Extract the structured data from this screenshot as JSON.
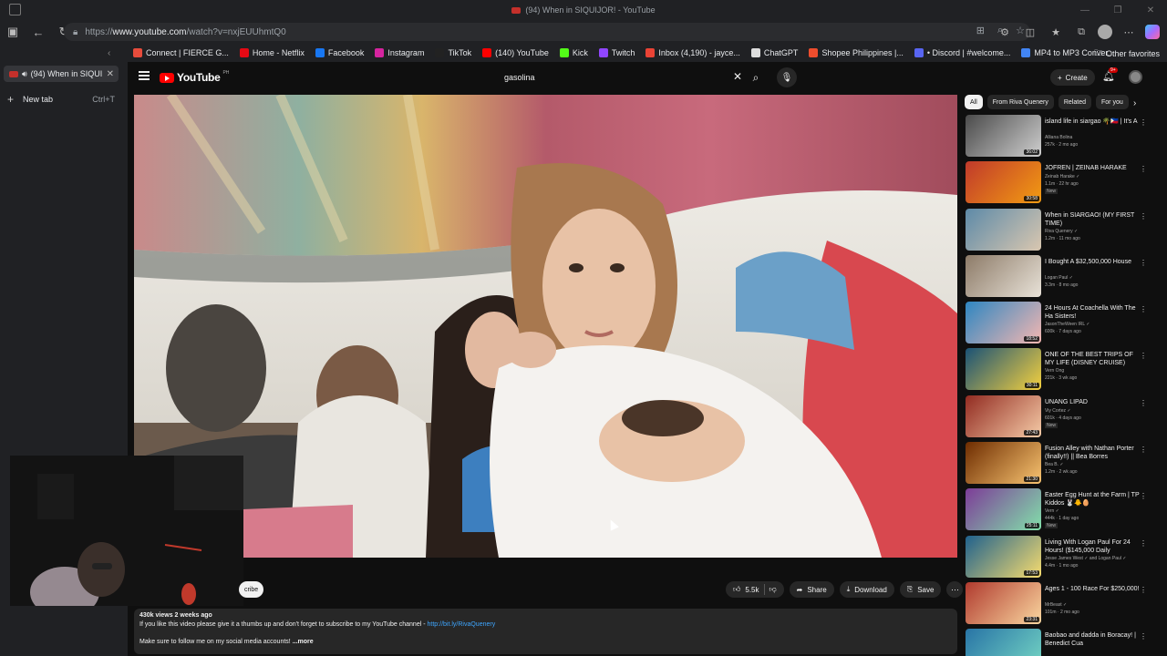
{
  "window": {
    "title": "(94) When in SIQUIJOR! - YouTube"
  },
  "address_bar": {
    "url_prefix": "https://",
    "url_host": "www.youtube.com",
    "url_path": "/watch?v=nxjEUUhmtQ0"
  },
  "bookmarks": [
    {
      "label": "Connect | FIERCE G...",
      "color": "#e74c3c"
    },
    {
      "label": "Home - Netflix",
      "color": "#e50914"
    },
    {
      "label": "Facebook",
      "color": "#1877f2"
    },
    {
      "label": "Instagram",
      "color": "#d6249f"
    },
    {
      "label": "TikTok",
      "color": "#222222"
    },
    {
      "label": "(140) YouTube",
      "color": "#ff0000"
    },
    {
      "label": "Kick",
      "color": "#53fc18"
    },
    {
      "label": "Twitch",
      "color": "#9146ff"
    },
    {
      "label": "Inbox (4,190) - jayce...",
      "color": "#ea4335"
    },
    {
      "label": "ChatGPT",
      "color": "#dddddd"
    },
    {
      "label": "Shopee Philippines |...",
      "color": "#ee4d2d"
    },
    {
      "label": "• Discord | #welcome...",
      "color": "#5865f2"
    },
    {
      "label": "MP4 to MP3 Conver...",
      "color": "#4285f4"
    }
  ],
  "other_favorites": "Other favorites",
  "sidebar": {
    "active_tab": "(94) When in SIQUI",
    "new_tab": "New tab",
    "new_tab_shortcut": "Ctrl+T"
  },
  "youtube": {
    "logo": "YouTube",
    "region": "PH",
    "search_value": "gasolina",
    "create_label": "Create",
    "notif_count": "9+"
  },
  "video": {
    "likes": "5.5k",
    "share": "Share",
    "download": "Download",
    "save": "Save",
    "subscribe_fragment": "cribe"
  },
  "description": {
    "meta": "430k views  2 weeks ago",
    "line1": "If you like this video please give it a thumbs up and don't forget to subscribe to my YouTube channel - ",
    "link": "http://bit.ly/RivaQuenery",
    "line2": "Make sure to follow me on my social media accounts!",
    "more": "...more"
  },
  "chips": [
    "All",
    "From Riva Quenery",
    "Related",
    "For you"
  ],
  "recommendations": [
    {
      "title": "island life in siargao 🌴🇵🇭 | It's A",
      "channel": "Alliana Bolina",
      "stats": "257k · 2 mo ago",
      "duration": "36:02",
      "new": false,
      "thumb": [
        "#4a4a4a",
        "#cfcfcf"
      ]
    },
    {
      "title": "JOFREN | ZEINAB HARAKE",
      "channel": "Zeinab Harake ✓",
      "stats": "1.1m · 22 hr ago",
      "duration": "30:58",
      "new": true,
      "thumb": [
        "#c0392b",
        "#f39c12"
      ]
    },
    {
      "title": "When in SIARGAO! (MY FIRST TIME)",
      "channel": "Riva Quenery ✓",
      "stats": "1.2m · 11 mo ago",
      "duration": "",
      "new": false,
      "thumb": [
        "#5d8aa8",
        "#d9c7b0"
      ]
    },
    {
      "title": "I Bought A $32,500,000 House",
      "channel": "Logan Paul ✓",
      "stats": "3.3m · 8 mo ago",
      "duration": "",
      "new": false,
      "thumb": [
        "#8d7b68",
        "#e8e2d8"
      ]
    },
    {
      "title": "24 Hours At Coachella With The Ha Sisters!",
      "channel": "JasonTheWeen IRL ✓",
      "stats": "600k · 7 days ago",
      "duration": "18:52",
      "new": false,
      "thumb": [
        "#2e86c1",
        "#f5b7b1"
      ]
    },
    {
      "title": "ONE OF THE BEST TRIPS OF MY LIFE (DISNEY CRUISE)",
      "channel": "Vern Ong",
      "stats": "221k · 3 wk ago",
      "duration": "30:11",
      "new": false,
      "thumb": [
        "#1a5276",
        "#f4d03f"
      ]
    },
    {
      "title": "UNANG LIPAD",
      "channel": "Viy Cortez ✓",
      "stats": "601k · 4 days ago",
      "duration": "27:43",
      "new": true,
      "thumb": [
        "#922b21",
        "#f5cba7"
      ]
    },
    {
      "title": "Fusion Alley with Nathan Porter (finally!!) || Bea Borres",
      "channel": "Bea B. ✓",
      "stats": "1.2m · 2 wk ago",
      "duration": "21:30",
      "new": false,
      "thumb": [
        "#6e2c00",
        "#f8c471"
      ]
    },
    {
      "title": "Easter Egg Hunt at the Farm | TP Kiddos 🐰🐥🥚",
      "channel": "Vern ✓",
      "stats": "444k · 1 day ago",
      "duration": "25:11",
      "new": true,
      "thumb": [
        "#7d3c98",
        "#82e0aa"
      ]
    },
    {
      "title": "Living With Logan Paul For 24 Hours! ($145,000 Daily",
      "channel": "Jesse James West ✓ and Logan Paul ✓",
      "stats": "4.4m · 1 mo ago",
      "duration": "17:53",
      "new": false,
      "thumb": [
        "#1f618d",
        "#f7dc6f"
      ]
    },
    {
      "title": "Ages 1 - 100 Race For $250,000!",
      "channel": "MrBeast ✓",
      "stats": "101m · 2 mo ago",
      "duration": "23:31",
      "new": false,
      "thumb": [
        "#b03a2e",
        "#fad7a0"
      ]
    },
    {
      "title": "Baobao and dadda in Boracay! | Benedict Cua",
      "channel": "",
      "stats": "",
      "duration": "",
      "new": false,
      "thumb": [
        "#2874a6",
        "#76d7c4"
      ]
    }
  ],
  "colors": {
    "background": "#0f0f0f",
    "chrome": "#202124",
    "pill": "#272727",
    "accent_red": "#ff0000",
    "link_blue": "#3ea6ff"
  }
}
